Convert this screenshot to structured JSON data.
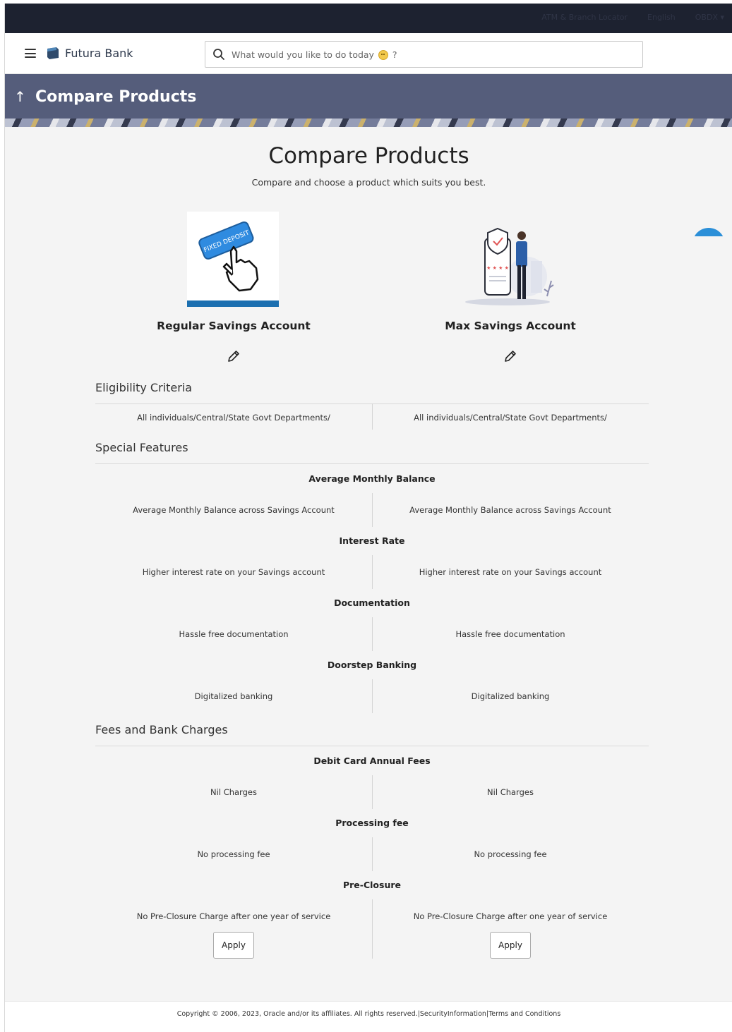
{
  "topbar": {
    "link_atm": "ATM & Branch Locator",
    "language": "English",
    "user": "OBDX ▾"
  },
  "header": {
    "bank_name": "Futura Bank",
    "search_placeholder": "What would you like to do today",
    "search_suffix": "?"
  },
  "banner": {
    "title": "Compare Products"
  },
  "main": {
    "title": "Compare Products",
    "subtitle": "Compare and choose a product which suits you best."
  },
  "products": [
    {
      "name": "Regular Savings Account",
      "image_caption": "FIXED DEPOSIT"
    },
    {
      "name": "Max Savings Account"
    }
  ],
  "sections": {
    "eligibility": {
      "title": "Eligibility Criteria",
      "values": [
        "All individuals/Central/State Govt Departments/",
        "All individuals/Central/State Govt Departments/"
      ]
    },
    "special": {
      "title": "Special Features",
      "features": [
        {
          "name": "Average Monthly Balance",
          "values": [
            "Average Monthly Balance across Savings Account",
            "Average Monthly Balance across Savings Account"
          ]
        },
        {
          "name": "Interest Rate",
          "values": [
            "Higher interest rate on your Savings account",
            "Higher interest rate on your Savings account"
          ]
        },
        {
          "name": "Documentation",
          "values": [
            "Hassle free documentation",
            "Hassle free documentation"
          ]
        },
        {
          "name": "Doorstep Banking",
          "values": [
            "Digitalized banking",
            "Digitalized banking"
          ]
        }
      ]
    },
    "fees": {
      "title": "Fees and Bank Charges",
      "features": [
        {
          "name": "Debit Card Annual Fees",
          "values": [
            "Nil Charges",
            "Nil Charges"
          ]
        },
        {
          "name": "Processing fee",
          "values": [
            "No processing fee",
            "No processing fee"
          ]
        },
        {
          "name": "Pre-Closure",
          "values": [
            "No Pre-Closure Charge after one year of service",
            "No Pre-Closure Charge after one year of service"
          ]
        }
      ]
    }
  },
  "actions": {
    "apply_label": "Apply"
  },
  "footer": {
    "copyright": "Copyright © 2006, 2023, Oracle and/or its affiliates. All rights reserved.|SecurityInformation|Terms and Conditions"
  },
  "colors": {
    "banner": "#555d7b",
    "topbar": "#1d2230",
    "accent": "#2b8fd8"
  }
}
